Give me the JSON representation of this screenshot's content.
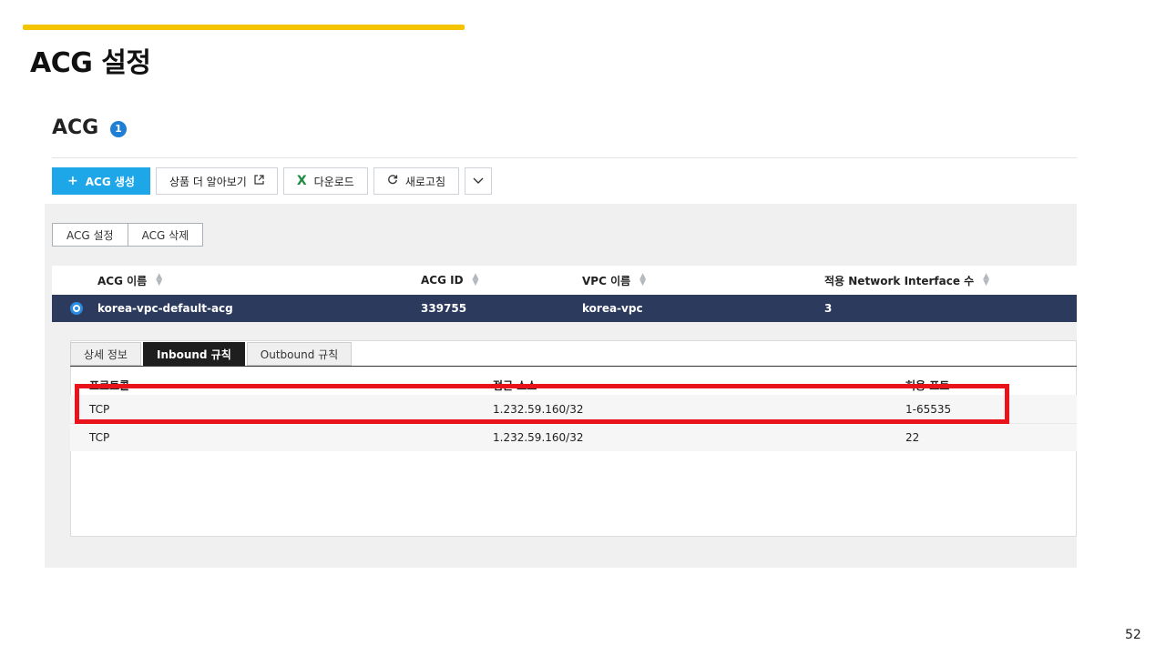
{
  "slide": {
    "title": "ACG 설정",
    "page_number": "52",
    "accent_color": "#f5c400",
    "highlight_color": "#e8131b"
  },
  "console": {
    "heading": "ACG",
    "badge": "1",
    "toolbar": {
      "create": "ACG 생성",
      "learn_more": "상품 더 알아보기",
      "download": "다운로드",
      "refresh": "새로고침"
    },
    "actions": {
      "settings": "ACG 설정",
      "delete": "ACG 삭제"
    },
    "acg_table": {
      "columns": [
        "ACG 이름",
        "ACG ID",
        "VPC 이름",
        "적용 Network Interface 수"
      ],
      "rows": [
        {
          "name": "korea-vpc-default-acg",
          "id": "339755",
          "vpc": "korea-vpc",
          "interfaces": "3",
          "selected": true
        }
      ]
    },
    "tabs": [
      {
        "label": "상세 정보",
        "active": false
      },
      {
        "label": "Inbound 규칙",
        "active": true
      },
      {
        "label": "Outbound 규칙",
        "active": false
      }
    ],
    "rules_table": {
      "columns": [
        "프로토콜",
        "접근 소스",
        "허용 포트"
      ],
      "rows": [
        {
          "protocol": "TCP",
          "source": "1.232.59.160/32",
          "port": "1-65535",
          "highlighted": true
        },
        {
          "protocol": "TCP",
          "source": "1.232.59.160/32",
          "port": "22",
          "highlighted": false
        }
      ]
    },
    "colors": {
      "primary_button": "#1ea7e8",
      "selected_row": "#2c3a5e",
      "active_tab": "#1e1e1e"
    }
  }
}
